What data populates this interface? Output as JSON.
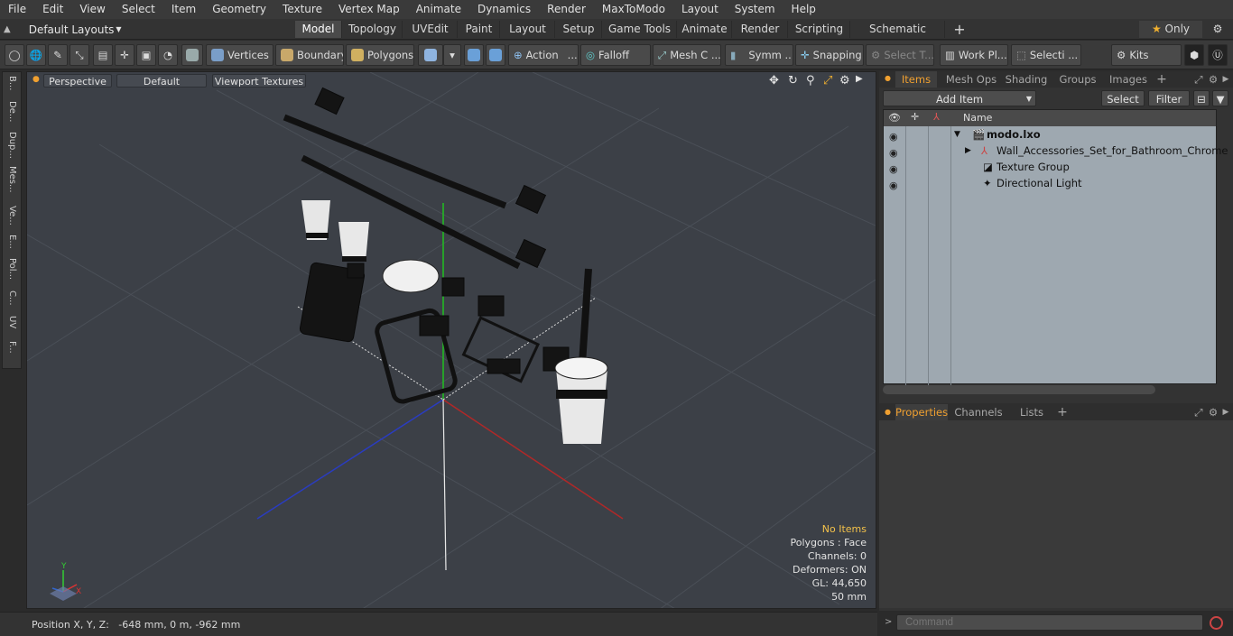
{
  "menu": [
    "File",
    "Edit",
    "View",
    "Select",
    "Item",
    "Geometry",
    "Texture",
    "Vertex Map",
    "Animate",
    "Dynamics",
    "Render",
    "MaxToModo",
    "Layout",
    "System",
    "Help"
  ],
  "layout": {
    "selector": "Default Layouts",
    "tabs": [
      "Model",
      "Topology",
      "UVEdit",
      "Paint",
      "Layout",
      "Setup",
      "Game Tools",
      "Animate",
      "Render",
      "Scripting",
      "Schematic Fusion"
    ],
    "active": "Model",
    "only_label": "Only"
  },
  "toolbar": {
    "vertices": "Vertices",
    "boundary": "Boundary",
    "polygons": "Polygons",
    "action": "Action",
    "falloff": "Falloff",
    "mesh": "Mesh C ...",
    "symmetry": "Symm ...",
    "snapping": "Snapping",
    "select_t": "Select T...",
    "work_plane": "Work Pl...",
    "selection": "Selecti ...",
    "kits": "Kits"
  },
  "left_tabs": [
    "B...",
    "De...",
    "Dup...",
    "Mes...",
    "Ve...",
    "E...",
    "Pol...",
    "C...",
    "UV",
    "F..."
  ],
  "viewport": {
    "perspective": "Perspective",
    "shading": "Default",
    "textures": "Viewport Textures",
    "hud": {
      "no_items": "No Items",
      "polygons": "Polygons : Face",
      "channels": "Channels: 0",
      "deformers": "Deformers: ON",
      "gl": "GL: 44,650",
      "scale": "50 mm"
    }
  },
  "status": {
    "position": "Position X, Y, Z:   -648 mm, 0 m, -962 mm"
  },
  "items_panel": {
    "tabs": [
      "Items",
      "Mesh Ops",
      "Shading",
      "Groups",
      "Images"
    ],
    "active": "Items",
    "add_item": "Add Item",
    "select": "Select",
    "filter": "Filter",
    "column_name": "Name",
    "rows": [
      {
        "label": "modo.lxo"
      },
      {
        "label": "Wall_Accessories_Set_for_Bathroom_Chrome"
      },
      {
        "label": "Texture Group"
      },
      {
        "label": "Directional Light"
      }
    ]
  },
  "props_panel": {
    "tabs": [
      "Properties",
      "Channels",
      "Lists"
    ],
    "active": "Properties"
  },
  "command": {
    "placeholder": "Command"
  }
}
